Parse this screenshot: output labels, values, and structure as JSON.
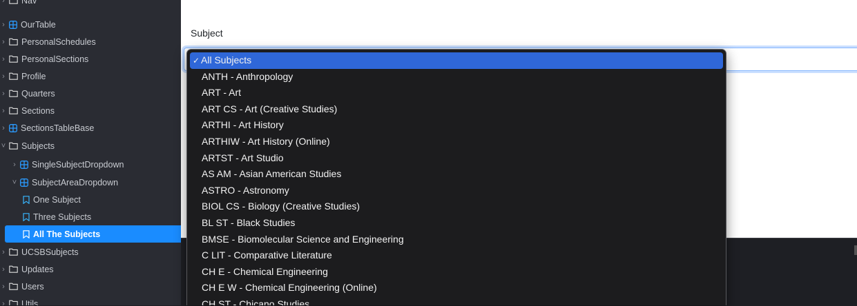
{
  "sidebar": {
    "items": [
      {
        "label": "Nav",
        "icon": "folder-icon",
        "level": 0,
        "chevron": "collapsed"
      },
      {
        "label": "OurTable",
        "icon": "component-icon",
        "level": 0,
        "chevron": "collapsed"
      },
      {
        "label": "PersonalSchedules",
        "icon": "folder-icon",
        "level": 0,
        "chevron": "collapsed"
      },
      {
        "label": "PersonalSections",
        "icon": "folder-icon",
        "level": 0,
        "chevron": "collapsed"
      },
      {
        "label": "Profile",
        "icon": "folder-icon",
        "level": 0,
        "chevron": "collapsed"
      },
      {
        "label": "Quarters",
        "icon": "folder-icon",
        "level": 0,
        "chevron": "collapsed"
      },
      {
        "label": "Sections",
        "icon": "folder-icon",
        "level": 0,
        "chevron": "collapsed"
      },
      {
        "label": "SectionsTableBase",
        "icon": "component-icon",
        "level": 0,
        "chevron": "collapsed"
      },
      {
        "label": "Subjects",
        "icon": "folder-icon",
        "level": 0,
        "chevron": "expanded"
      },
      {
        "label": "SingleSubjectDropdown",
        "icon": "component-icon",
        "level": 1,
        "chevron": "collapsed"
      },
      {
        "label": "SubjectAreaDropdown",
        "icon": "component-icon",
        "level": 1,
        "chevron": "expanded"
      },
      {
        "label": "One Subject",
        "icon": "bookmark-icon",
        "level": 2,
        "chevron": "none"
      },
      {
        "label": "Three Subjects",
        "icon": "bookmark-icon",
        "level": 2,
        "chevron": "none"
      },
      {
        "label": "All The Subjects",
        "icon": "bookmark-icon",
        "level": 2,
        "chevron": "none",
        "selected": true
      },
      {
        "label": "UCSBSubjects",
        "icon": "folder-icon",
        "level": 0,
        "chevron": "collapsed"
      },
      {
        "label": "Updates",
        "icon": "folder-icon",
        "level": 0,
        "chevron": "collapsed"
      },
      {
        "label": "Users",
        "icon": "folder-icon",
        "level": 0,
        "chevron": "collapsed"
      },
      {
        "label": "Utils",
        "icon": "folder-icon",
        "level": 0,
        "chevron": "collapsed"
      }
    ]
  },
  "form": {
    "subject_label": "Subject",
    "selected_value": "All Subjects"
  },
  "dropdown": {
    "options": [
      {
        "label": "All Subjects",
        "checked": true
      },
      {
        "label": "ANTH - Anthropology"
      },
      {
        "label": "ART - Art"
      },
      {
        "label": "ART CS - Art (Creative Studies)"
      },
      {
        "label": "ARTHI - Art History"
      },
      {
        "label": "ARTHIW - Art History (Online)"
      },
      {
        "label": "ARTST - Art Studio"
      },
      {
        "label": "AS AM - Asian American Studies"
      },
      {
        "label": "ASTRO - Astronomy"
      },
      {
        "label": "BIOL CS - Biology (Creative Studies)"
      },
      {
        "label": "BL ST - Black Studies"
      },
      {
        "label": "BMSE - Biomolecular Science and Engineering"
      },
      {
        "label": "C LIT - Comparative Literature"
      },
      {
        "label": "CH E - Chemical Engineering"
      },
      {
        "label": "CH E W - Chemical Engineering (Online)"
      },
      {
        "label": "CH ST - Chicano Studies"
      }
    ]
  },
  "colors": {
    "sidebar_bg": "#2a2c33",
    "selected_bg": "#1a8cff",
    "folder_icon": "#e0e0e0",
    "component_icon": "#2b9bff",
    "bookmark_icon": "#38b6ff",
    "dropdown_bg": "#1c1c1e",
    "dropdown_checked_bg": "#2f67d8"
  }
}
